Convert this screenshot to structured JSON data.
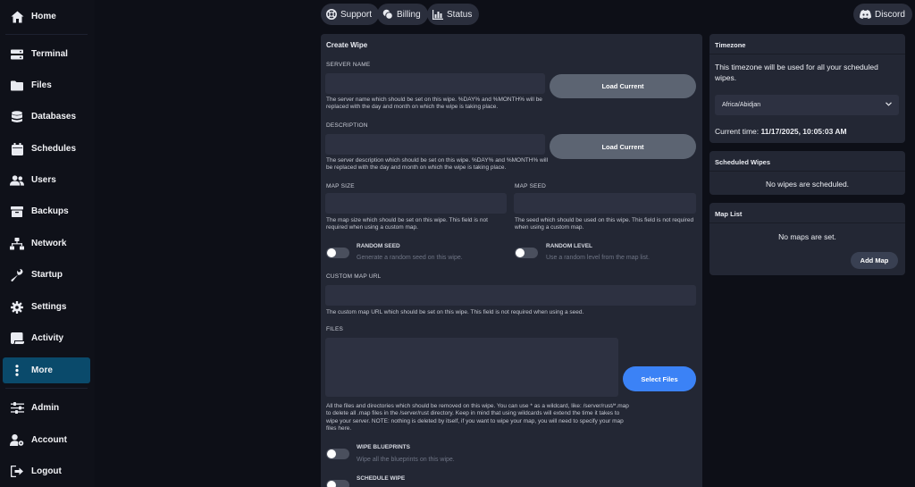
{
  "sidebar": {
    "items": [
      {
        "label": "Home",
        "icon": "home-icon"
      },
      {
        "label": "Terminal",
        "icon": "terminal-icon"
      },
      {
        "label": "Files",
        "icon": "folder-icon"
      },
      {
        "label": "Databases",
        "icon": "database-icon"
      },
      {
        "label": "Schedules",
        "icon": "calendar-icon"
      },
      {
        "label": "Users",
        "icon": "users-icon"
      },
      {
        "label": "Backups",
        "icon": "archive-icon"
      },
      {
        "label": "Network",
        "icon": "network-icon"
      },
      {
        "label": "Startup",
        "icon": "wrench-icon"
      },
      {
        "label": "Settings",
        "icon": "gear-icon"
      },
      {
        "label": "Activity",
        "icon": "scroll-icon"
      },
      {
        "label": "More",
        "icon": "ellipsis-vertical-icon"
      },
      {
        "label": "Admin",
        "icon": "sliders-icon"
      },
      {
        "label": "Account",
        "icon": "user-cog-icon"
      },
      {
        "label": "Logout",
        "icon": "logout-icon"
      }
    ],
    "active": "More"
  },
  "topbar": {
    "support": "Support",
    "billing": "Billing",
    "status": "Status",
    "discord": "Discord"
  },
  "wipe": {
    "title": "Create Wipe",
    "server_name": {
      "label": "SERVER NAME",
      "value": "",
      "button": "Load Current",
      "help": "The server name which should be set on this wipe. %DAY% and %MONTH% will be replaced with the day and month on which the wipe is taking place."
    },
    "description": {
      "label": "DESCRIPTION",
      "value": "",
      "button": "Load Current",
      "help": "The server description which should be set on this wipe. %DAY% and %MONTH% will be replaced with the day and month on which the wipe is taking place."
    },
    "map_size": {
      "label": "MAP SIZE",
      "value": "",
      "help": "The map size which should be set on this wipe. This field is not required when using a custom map."
    },
    "map_seed": {
      "label": "MAP SEED",
      "value": "",
      "help": "The seed which should be used on this wipe. This field is not required when using a custom map."
    },
    "random_seed": {
      "label": "RANDOM SEED",
      "desc": "Generate a random seed on this wipe.",
      "enabled": false
    },
    "random_level": {
      "label": "RANDOM LEVEL",
      "desc": "Use a random level from the map list.",
      "enabled": false
    },
    "custom_map_url": {
      "label": "CUSTOM MAP URL",
      "value": "",
      "help": "The custom map URL which should be set on this wipe. This field is not required when using a seed."
    },
    "files": {
      "label": "FILES",
      "value": "",
      "button": "Select Files",
      "help": "All the files and directories which should be removed on this wipe. You can use * as a wildcard, like: /server/rust/*.map to delete all .map files in the /server/rust directory. Keep in mind that using wildcards will extend the time it takes to wipe your server. NOTE: nothing is deleted by itself, if you want to wipe your map, you will need to specify your map files here."
    },
    "wipe_blueprints": {
      "label": "WIPE BLUEPRINTS",
      "desc": "Wipe all the blueprints on this wipe.",
      "enabled": false
    },
    "schedule_wipe": {
      "label": "SCHEDULE WIPE",
      "enabled": false
    }
  },
  "timezone": {
    "title": "Timezone",
    "text": "This timezone will be used for all your scheduled wipes.",
    "selected": "Africa/Abidjan",
    "current_label": "Current time:",
    "current_value": "11/17/2025, 10:05:03 AM"
  },
  "scheduled": {
    "title": "Scheduled Wipes",
    "empty": "No wipes are scheduled."
  },
  "maplist": {
    "title": "Map List",
    "empty": "No maps are set.",
    "button": "Add Map"
  },
  "colors": {
    "accent": "#3b82f6",
    "active_nav": "#0a4a6b",
    "panel": "#232734"
  }
}
